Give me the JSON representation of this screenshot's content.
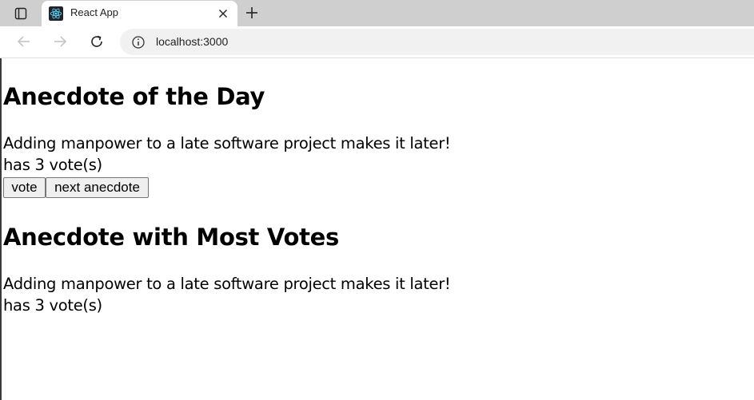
{
  "browser": {
    "tab": {
      "title": "React App",
      "favicon": "react-logo-icon"
    },
    "address_bar": {
      "url": "localhost:3000"
    },
    "icons": {
      "window": "window-icon",
      "close": "close-icon",
      "new_tab": "plus-icon",
      "back": "back-arrow-icon",
      "forward": "forward-arrow-icon",
      "reload": "reload-icon",
      "info": "info-icon"
    }
  },
  "page": {
    "day_section": {
      "heading": "Anecdote of the Day",
      "anecdote": "Adding manpower to a late software project makes it later!",
      "votes_text": "has 3 vote(s)"
    },
    "buttons": {
      "vote_label": "vote",
      "next_label": "next anecdote"
    },
    "most_votes_section": {
      "heading": "Anecdote with Most Votes",
      "anecdote": "Adding manpower to a late software project makes it later!",
      "votes_text": "has 3 vote(s)"
    }
  }
}
